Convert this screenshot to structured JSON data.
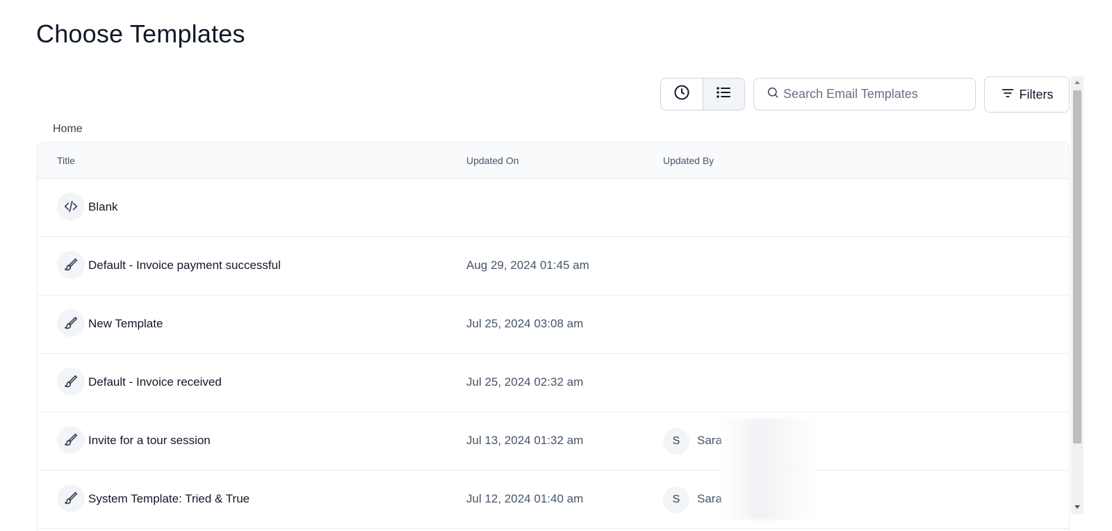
{
  "page": {
    "title": "Choose Templates"
  },
  "toolbar": {
    "recent_view_icon": "clock-icon",
    "list_view_icon": "list-icon",
    "search": {
      "placeholder": "Search Email Templates",
      "value": ""
    },
    "filters_label": "Filters"
  },
  "breadcrumb": {
    "current": "Home"
  },
  "table": {
    "columns": [
      "Title",
      "Updated On",
      "Updated By"
    ],
    "rows": [
      {
        "icon": "code-icon",
        "title": "Blank",
        "updated_on": "",
        "updated_by_initial": "",
        "updated_by": ""
      },
      {
        "icon": "brush-icon",
        "title": "Default - Invoice payment successful",
        "updated_on": "Aug 29, 2024 01:45 am",
        "updated_by_initial": "",
        "updated_by": ""
      },
      {
        "icon": "brush-icon",
        "title": "New Template",
        "updated_on": "Jul 25, 2024 03:08 am",
        "updated_by_initial": "",
        "updated_by": ""
      },
      {
        "icon": "brush-icon",
        "title": "Default - Invoice received",
        "updated_on": "Jul 25, 2024 02:32 am",
        "updated_by_initial": "",
        "updated_by": ""
      },
      {
        "icon": "brush-icon",
        "title": "Invite for a tour session",
        "updated_on": "Jul 13, 2024 01:32 am",
        "updated_by_initial": "S",
        "updated_by": "Sara"
      },
      {
        "icon": "brush-icon",
        "title": "System Template: Tried & True",
        "updated_on": "Jul 12, 2024 01:40 am",
        "updated_by_initial": "S",
        "updated_by": "Sara"
      }
    ]
  }
}
